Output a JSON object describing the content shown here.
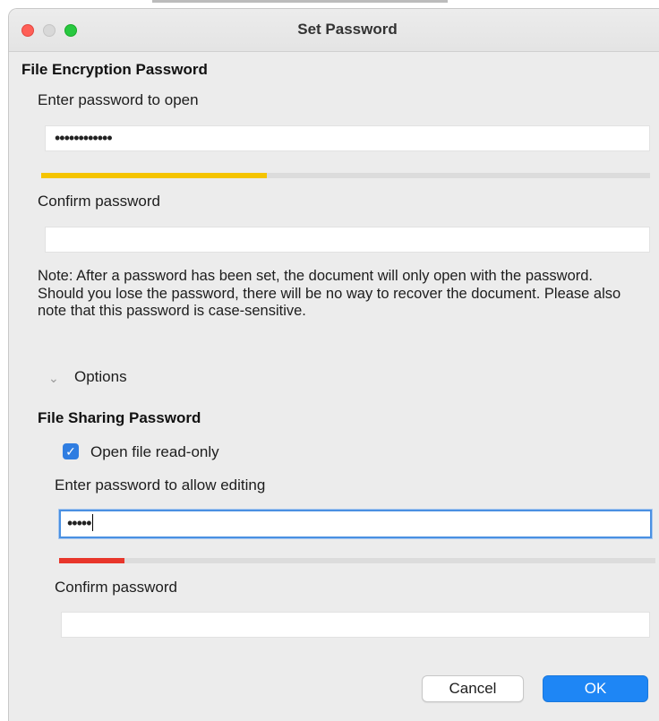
{
  "window": {
    "title": "Set Password"
  },
  "encryption": {
    "heading": "File Encryption Password",
    "open_label": "Enter password to open",
    "open_value": "••••••••••••",
    "open_strength": 0.37,
    "open_strength_color": "#f5c400",
    "confirm_label": "Confirm password",
    "confirm_value": ""
  },
  "note": "Note: After a password has been set, the document will only open with the password. Should you lose the password, there will be no way to recover the document. Please also note that this password is case-sensitive.",
  "options": {
    "label": "Options",
    "expanded": true
  },
  "sharing": {
    "heading": "File Sharing Password",
    "readonly_label": "Open file read-only",
    "readonly_checked": true,
    "edit_label": "Enter password to allow editing",
    "edit_value": "•••••",
    "edit_strength": 0.11,
    "edit_strength_color": "#e8362b",
    "confirm_label": "Confirm password",
    "confirm_value": ""
  },
  "buttons": {
    "cancel": "Cancel",
    "ok": "OK"
  }
}
